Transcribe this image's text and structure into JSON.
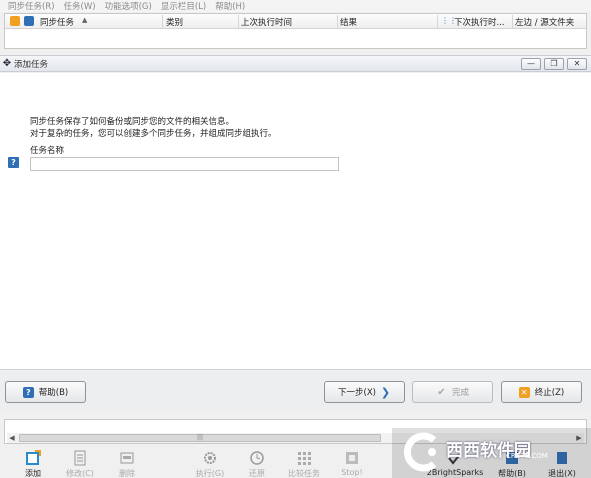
{
  "menu": {
    "items": [
      "同步任务(R)",
      "任务(W)",
      "功能选项(G)",
      "显示栏目(L)",
      "帮助(H)"
    ]
  },
  "task_list": {
    "columns": [
      "同步任务",
      "类别",
      "上次执行时间",
      "结果",
      "下次执行时...",
      "左边 / 源文件夹"
    ]
  },
  "dialog": {
    "title": "添加任务",
    "info_line1": "同步任务保存了如何备份或同步您的文件的相关信息。",
    "info_line2": "对于复杂的任务，您可以创建多个同步任务，并组成同步组执行。",
    "name_label": "任务名称",
    "name_value": "",
    "help_icon": "?"
  },
  "buttons": {
    "help": "帮助(B)",
    "next": "下一步(X)",
    "finish": "完成",
    "stop": "终止(Z)"
  },
  "window_controls": {
    "minimize": "—",
    "restore": "❐",
    "close": "✕"
  },
  "bottom_toolbar": {
    "items": [
      "添加",
      "修改(C)",
      "删除",
      "执行(G)",
      "还原",
      "比较任务",
      "Stop!",
      "2BrightSparks",
      "帮助(B)",
      "退出(X)"
    ]
  },
  "watermark": {
    "text": "西西软件园",
    "url": "CR173.COM"
  },
  "colors": {
    "accent": "#2f6fb6",
    "stop_orange": "#f0a020",
    "menu_text": "#8a8a8a"
  }
}
